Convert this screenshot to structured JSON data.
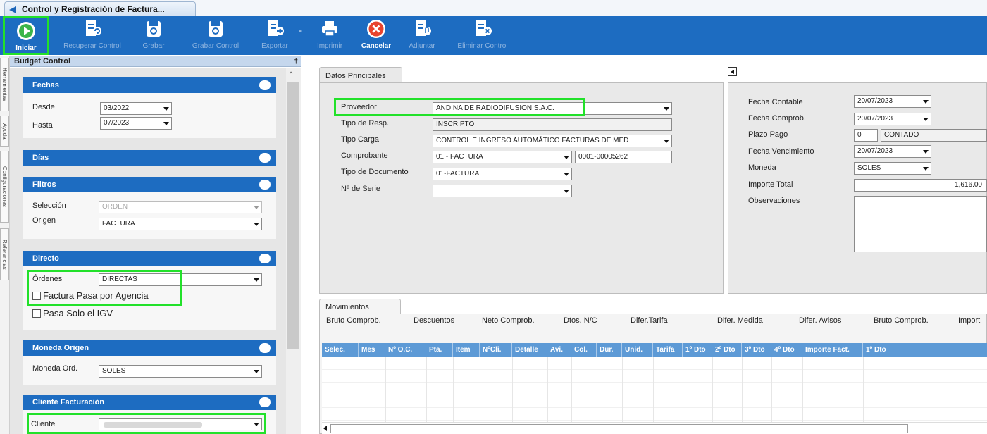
{
  "window": {
    "tab_title": "Control y Registración de Factura..."
  },
  "toolbar": {
    "buttons": [
      {
        "label": "Iniciar",
        "icon": "play-icon",
        "enabled": true
      },
      {
        "label": "Recuperar Control",
        "icon": "document-recover-icon",
        "enabled": false
      },
      {
        "label": "Grabar",
        "icon": "save-disk-icon",
        "enabled": false
      },
      {
        "label": "Grabar Control",
        "icon": "save-disk-icon",
        "enabled": false
      },
      {
        "label": "Exportar",
        "icon": "document-export-icon",
        "enabled": false
      },
      {
        "label": "Imprimir",
        "icon": "printer-icon",
        "enabled": false
      },
      {
        "label": "Cancelar",
        "icon": "cancel-x-icon",
        "enabled": true
      },
      {
        "label": "Adjuntar",
        "icon": "document-attach-icon",
        "enabled": false
      },
      {
        "label": "Eliminar Control",
        "icon": "document-delete-icon",
        "enabled": false
      }
    ],
    "separator": "-"
  },
  "side_tabs": [
    "Herramientas",
    "Ayuda",
    "Configuraciones",
    "Referencias"
  ],
  "budget_panel": {
    "title": "Budget Control",
    "pin": "†",
    "sections": {
      "fechas": {
        "title": "Fechas",
        "desde_label": "Desde",
        "desde_value": "03/2022",
        "hasta_label": "Hasta",
        "hasta_value": "07/2023"
      },
      "dias": {
        "title": "Días"
      },
      "filtros": {
        "title": "Filtros",
        "seleccion_label": "Selección",
        "seleccion_value": "ORDEN",
        "origen_label": "Origen",
        "origen_value": "FACTURA"
      },
      "directo": {
        "title": "Directo",
        "ordenes_label": "Órdenes",
        "ordenes_value": "DIRECTAS",
        "check_agencia": "Factura Pasa por Agencia",
        "check_igv": "Pasa Solo el IGV"
      },
      "moneda": {
        "title": "Moneda Origen",
        "moneda_label": "Moneda Ord.",
        "moneda_value": "SOLES"
      },
      "cliente": {
        "title": "Cliente Facturación",
        "cliente_label": "Cliente",
        "cliente_value": ""
      }
    }
  },
  "datos_principales": {
    "tab_label": "Datos Principales",
    "proveedor_label": "Proveedor",
    "proveedor_value": "ANDINA DE RADIODIFUSION S.A.C.",
    "tipo_resp_label": "Tipo de Resp.",
    "tipo_resp_value": "INSCRIPTO",
    "tipo_carga_label": "Tipo Carga",
    "tipo_carga_value": "CONTROL E INGRESO AUTOMÁTICO FACTURAS DE MED",
    "comprobante_label": "Comprobante",
    "comprobante_value": "01 - FACTURA",
    "comprobante_numero": "0001-00005262",
    "tipo_doc_label": "Tipo de Documento",
    "tipo_doc_value": "01-FACTURA",
    "serie_label": "Nº de Serie",
    "serie_value": ""
  },
  "right_panel": {
    "fecha_contable_label": "Fecha Contable",
    "fecha_contable_value": "20/07/2023",
    "fecha_comprob_label": "Fecha Comprob.",
    "fecha_comprob_value": "20/07/2023",
    "plazo_label": "Plazo Pago",
    "plazo_days": "0",
    "plazo_text": "CONTADO",
    "vencimiento_label": "Fecha Vencimiento",
    "vencimiento_value": "20/07/2023",
    "moneda_label": "Moneda",
    "moneda_value": "SOLES",
    "importe_label": "Importe Total",
    "importe_value": "1,616.00",
    "observaciones_label": "Observaciones",
    "observaciones_value": ""
  },
  "movimientos": {
    "tab_label": "Movimientos",
    "summary_labels": [
      "Bruto Comprob.",
      "Descuentos",
      "Neto Comprob.",
      "Dtos. N/C",
      "Difer.Tarifa",
      "Difer. Medida",
      "Difer. Avisos",
      "Bruto Comprob.",
      "Import"
    ],
    "columns": [
      "Selec.",
      "Mes",
      "Nº O.C.",
      "Pta.",
      "Item",
      "NºCli.",
      "Detalle",
      "Avi.",
      "Col.",
      "Dur.",
      "Unid.",
      "Tarifa",
      "1º Dto",
      "2º Dto",
      "3º Dto",
      "4º Dto",
      "Importe Fact.",
      "1º Dto"
    ]
  },
  "colors": {
    "toolbar_blue": "#1d6cc1",
    "section_blue": "#1d6cc1",
    "grid_header": "#5d9ad6",
    "highlight_green": "#22e12a"
  }
}
